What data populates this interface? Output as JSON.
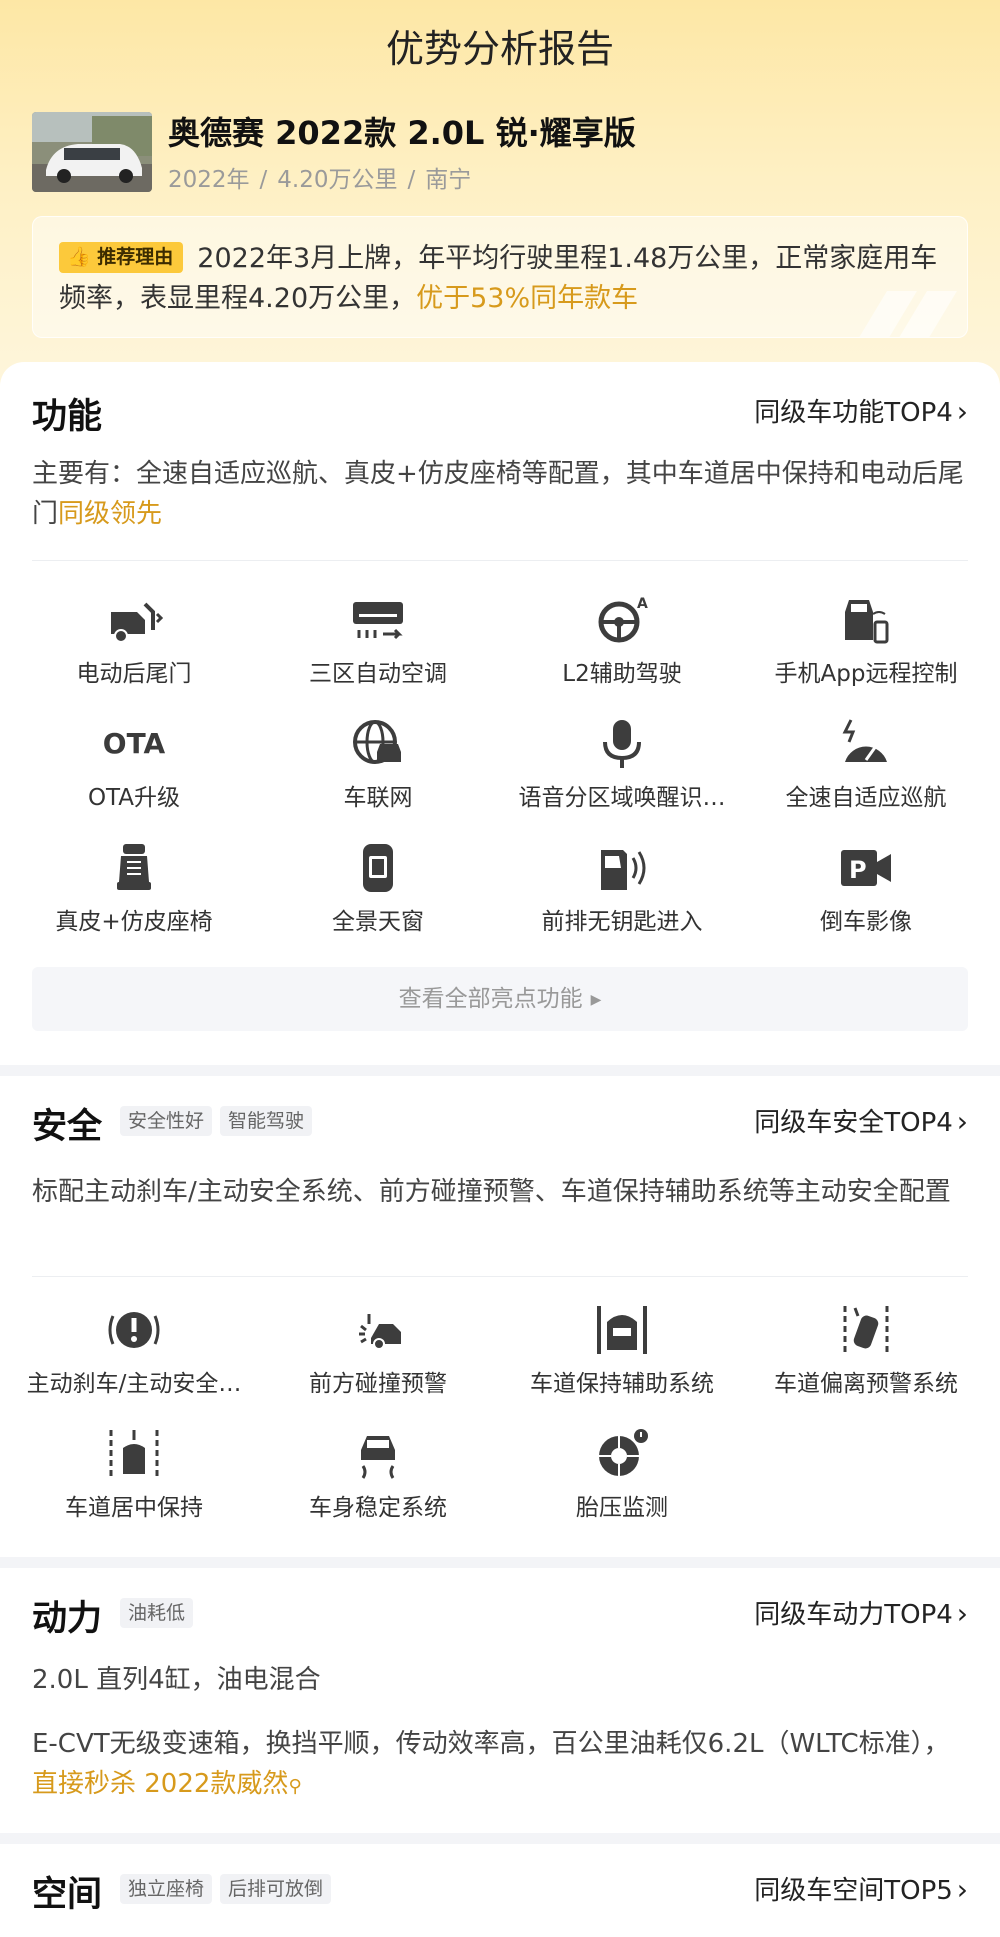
{
  "page": {
    "title": "优势分析报告"
  },
  "car": {
    "name": "奥德赛 2022款 2.0L 锐·耀享版",
    "year": "2022年",
    "mileage": "4.20万公里",
    "city": "南宁",
    "meta_sep": "/"
  },
  "reason": {
    "badge": "推荐理由",
    "text": "2022年3月上牌，年平均行驶里程1.48万公里，正常家庭用车频率，表显里程4.20万公里，",
    "highlight": "优于53%同年款车"
  },
  "function": {
    "title": "功能",
    "link": "同级车功能TOP4",
    "desc": "主要有：全速自适应巡航、真皮+仿皮座椅等配置，其中车道居中保持和电动后尾门",
    "desc_highlight": "同级领先",
    "items": [
      {
        "label": "电动后尾门",
        "icon": "power-tailgate-icon"
      },
      {
        "label": "三区自动空调",
        "icon": "air-conditioner-icon"
      },
      {
        "label": "L2辅助驾驶",
        "icon": "steering-wheel-icon"
      },
      {
        "label": "手机App远程控制",
        "icon": "phone-remote-icon"
      },
      {
        "label": "OTA升级",
        "icon": "ota-icon",
        "glyph": "OTA"
      },
      {
        "label": "车联网",
        "icon": "globe-car-icon"
      },
      {
        "label": "语音分区域唤醒识…",
        "icon": "microphone-icon"
      },
      {
        "label": "全速自适应巡航",
        "icon": "speedometer-icon"
      },
      {
        "label": "真皮+仿皮座椅",
        "icon": "seat-icon"
      },
      {
        "label": "全景天窗",
        "icon": "sunroof-icon"
      },
      {
        "label": "前排无钥匙进入",
        "icon": "keyless-door-icon"
      },
      {
        "label": "倒车影像",
        "icon": "parking-camera-icon"
      }
    ],
    "more": "查看全部亮点功能"
  },
  "safety": {
    "title": "安全",
    "tags": [
      "安全性好",
      "智能驾驶"
    ],
    "link": "同级车安全TOP4",
    "desc": "标配主动刹车/主动安全系统、前方碰撞预警、车道保持辅助系统等主动安全配置",
    "items": [
      {
        "label": "主动刹车/主动安全…",
        "icon": "brake-warning-icon"
      },
      {
        "label": "前方碰撞预警",
        "icon": "collision-warning-icon"
      },
      {
        "label": "车道保持辅助系统",
        "icon": "lane-keep-icon"
      },
      {
        "label": "车道偏离预警系统",
        "icon": "lane-departure-icon"
      },
      {
        "label": "车道居中保持",
        "icon": "lane-center-icon"
      },
      {
        "label": "车身稳定系统",
        "icon": "stability-icon"
      },
      {
        "label": "胎压监测",
        "icon": "tire-pressure-icon"
      }
    ]
  },
  "power": {
    "title": "动力",
    "tags": [
      "油耗低"
    ],
    "link": "同级车动力TOP4",
    "line1": "2.0L 直列4缸，油电混合",
    "line2": "E-CVT无级变速箱，换挡平顺，传动效率高，百公里油耗仅6.2L（WLTC标准），",
    "line2_link": "直接秒杀 2022款威然"
  },
  "space": {
    "title": "空间",
    "tags": [
      "独立座椅",
      "后排可放倒"
    ],
    "link": "同级车空间TOP5"
  },
  "colors": {
    "accent": "#d79a1c",
    "badge": "#fcc93b",
    "icon": "#3d3d3d"
  }
}
